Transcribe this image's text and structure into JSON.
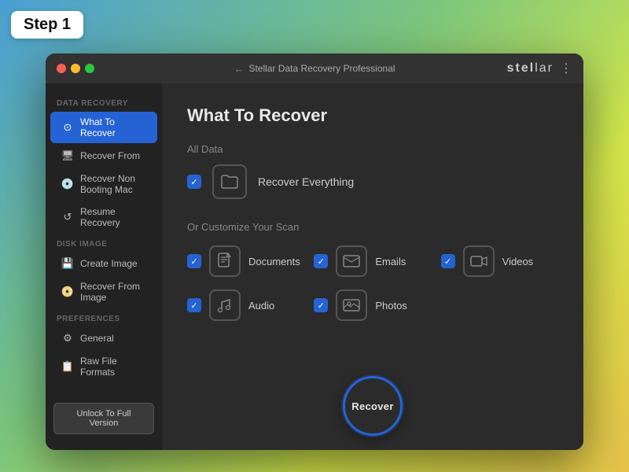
{
  "background": {
    "gradient": "linear-gradient(135deg, #4a9fd4, #7bc67e, #d4e84a, #e8c44a)"
  },
  "step_badge": "Step 1",
  "title_bar": {
    "back_arrow": "←",
    "title": "Stellar Data Recovery Professional",
    "brand": "stellar",
    "more_icon": "⋮"
  },
  "sidebar": {
    "sections": [
      {
        "label": "Data Recovery",
        "items": [
          {
            "id": "what-to-recover",
            "label": "What To Recover",
            "icon": "⊙",
            "active": true
          },
          {
            "id": "recover-from",
            "label": "Recover From",
            "icon": "🖥",
            "active": false
          },
          {
            "id": "recover-non-booting",
            "label": "Recover Non Booting Mac",
            "icon": "💿",
            "active": false
          },
          {
            "id": "resume-recovery",
            "label": "Resume Recovery",
            "icon": "↺",
            "active": false
          }
        ]
      },
      {
        "label": "Disk Image",
        "items": [
          {
            "id": "create-image",
            "label": "Create Image",
            "icon": "💾",
            "active": false
          },
          {
            "id": "recover-from-image",
            "label": "Recover From Image",
            "icon": "📀",
            "active": false
          }
        ]
      },
      {
        "label": "Preferences",
        "items": [
          {
            "id": "general",
            "label": "General",
            "icon": "⚙",
            "active": false
          },
          {
            "id": "raw-file-formats",
            "label": "Raw File Formats",
            "icon": "📋",
            "active": false
          }
        ]
      }
    ],
    "unlock_button": "Unlock To Full Version"
  },
  "main": {
    "page_title": "What To Recover",
    "all_data_label": "All Data",
    "recover_everything_label": "Recover Everything",
    "customize_label": "Or Customize Your Scan",
    "scan_items": [
      {
        "id": "documents",
        "label": "Documents",
        "icon": "📄",
        "checked": true
      },
      {
        "id": "emails",
        "label": "Emails",
        "icon": "✉",
        "checked": true
      },
      {
        "id": "videos",
        "label": "Videos",
        "icon": "🎬",
        "checked": true
      },
      {
        "id": "audio",
        "label": "Audio",
        "icon": "🎵",
        "checked": true
      },
      {
        "id": "photos",
        "label": "Photos",
        "icon": "📷",
        "checked": true
      }
    ],
    "recover_button": "Recover"
  }
}
